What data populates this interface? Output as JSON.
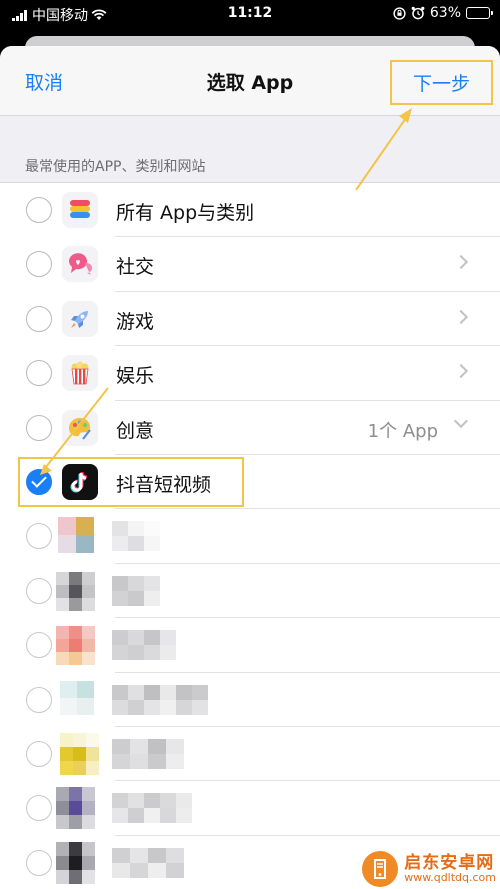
{
  "status_bar": {
    "carrier": "中国移动",
    "time": "11:12",
    "battery": "63%",
    "battery_level": 0.63
  },
  "nav": {
    "cancel_label": "取消",
    "title": "选取 App",
    "next_label": "下一步"
  },
  "section_header": "最常使用的APP、类别和网站",
  "rows": [
    {
      "label": "所有 App与类别",
      "icon": "stack-icon",
      "checked": false,
      "accessory": "none"
    },
    {
      "label": "社交",
      "icon": "chat-heart-icon",
      "checked": false,
      "accessory": "chevron-right"
    },
    {
      "label": "游戏",
      "icon": "rocket-icon",
      "checked": false,
      "accessory": "chevron-right"
    },
    {
      "label": "娱乐",
      "icon": "popcorn-icon",
      "checked": false,
      "accessory": "chevron-right"
    },
    {
      "label": "创意",
      "icon": "palette-icon",
      "checked": false,
      "accessory": "chevron-down",
      "count": "1个 App"
    },
    {
      "label": "抖音短视频",
      "icon": "tiktok-icon",
      "checked": true,
      "accessory": "none"
    }
  ],
  "blurred_row_count": 7,
  "colors": {
    "accent": "#1a7ff5",
    "highlight": "#f2c54a",
    "watermark": "#e56b17"
  },
  "watermark": {
    "title": "启东安卓网",
    "url": "www.qdltdq.com"
  }
}
